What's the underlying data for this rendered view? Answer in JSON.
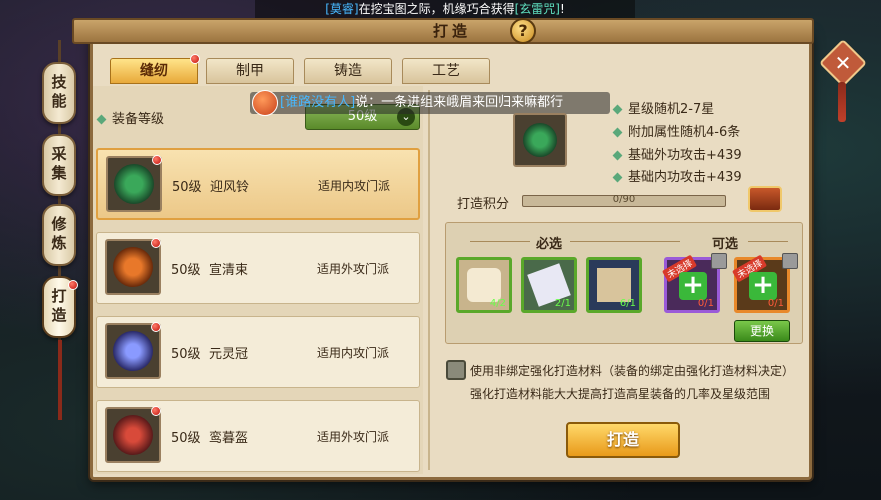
{
  "broadcast": {
    "bracket_open": "[",
    "player": "莫睿",
    "bracket_close": "]",
    "text_a": "在挖宝图之际，机缘巧合获得",
    "item": "[玄雷咒]",
    "text_b": "!"
  },
  "side_tabs": [
    "技能",
    "采集",
    "修炼",
    "打造"
  ],
  "title": "打造",
  "help": "?",
  "close": "✕",
  "category_tabs": [
    "缝纫",
    "制甲",
    "铸造",
    "工艺"
  ],
  "equip_level_label": "装备等级",
  "level_select": {
    "value": "50级",
    "chevron": "⌄"
  },
  "chat": {
    "who": "[谁路没有人]",
    "says": "说：",
    "msg": "一条进组来峨眉来回归来嘛都行"
  },
  "items": [
    {
      "level": "50级",
      "name": "迎风铃",
      "sect": "适用内攻门派",
      "color": "#3aa85a"
    },
    {
      "level": "50级",
      "name": "宣清束",
      "sect": "适用外攻门派",
      "color": "#e8782a"
    },
    {
      "level": "50级",
      "name": "元灵冠",
      "sect": "适用内攻门派",
      "color": "#5a6ad8"
    },
    {
      "level": "50级",
      "name": "鸾暮盔",
      "sect": "适用外攻门派",
      "color": "#a82a2a"
    }
  ],
  "stats": [
    "星级随机2-7星",
    "附加属性随机4-6条",
    "基础外功攻击+439",
    "基础内功攻击+439"
  ],
  "score": {
    "label": "打造积分",
    "text": "0/90",
    "current": 0,
    "max": 90
  },
  "materials": {
    "required_label": "必选",
    "optional_label": "可选",
    "required": [
      {
        "count": "4/2",
        "icon": "cloth-icon"
      },
      {
        "count": "2/1",
        "icon": "scroll-icon"
      },
      {
        "count": "6/1",
        "icon": "paper-icon"
      }
    ],
    "optional": [
      {
        "count": "0/1",
        "tag": "未选择"
      },
      {
        "count": "0/1",
        "tag": "未选择"
      }
    ],
    "swap_label": "更换"
  },
  "bind_option": "使用非绑定强化打造材料（装备的绑定由强化打造材料决定）",
  "bind_note": "强化打造材料能大大提高打造高星装备的几率及星级范围",
  "forge_button": "打造"
}
